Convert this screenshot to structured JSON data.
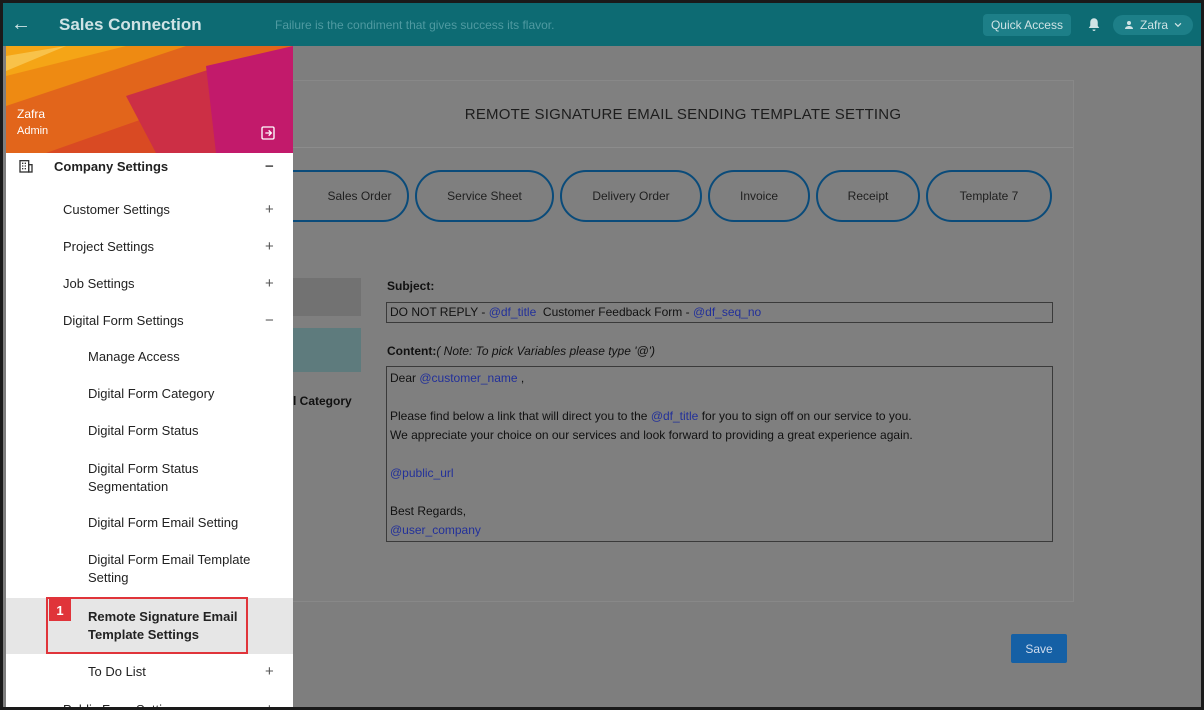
{
  "topbar": {
    "app_title": "Sales Connection",
    "quote": "Failure is the condiment that gives success its flavor.",
    "quick_access": "Quick Access",
    "user_name": "Zafra"
  },
  "panel": {
    "title": "REMOTE SIGNATURE EMAIL SENDING TEMPLATE SETTING",
    "tabs": [
      "Sales Order",
      "Service Sheet",
      "Delivery Order",
      "Invoice",
      "Receipt",
      "Template 7"
    ],
    "category_fragment": "l Category",
    "subject_label": "Subject:",
    "subject": {
      "p1": "DO NOT REPLY - ",
      "v1": "@df_title",
      "p2": "  Customer Feedback Form - ",
      "v2": "@df_seq_no"
    },
    "content_label": "Content:",
    "content_note": "( Note: To pick Variables please type '@')",
    "content": {
      "greet": "Dear ",
      "greet_var": "@customer_name",
      "greet_end": " ,",
      "line1_a": "Please find below a link that will direct you to the ",
      "line1_var": "@df_title",
      "line1_b": " for you to sign off on our service to you.",
      "line2": "We appreciate your choice on our services and look forward to providing a great experience again.",
      "url_var": "@public_url",
      "regards": "Best Regards,",
      "company_var": "@user_company"
    },
    "save": "Save"
  },
  "sidebar": {
    "user_name": "Zafra",
    "user_role": "Admin",
    "company_settings": "Company Settings",
    "items": [
      "Customer Settings",
      "Project Settings",
      "Job Settings",
      "Digital Form Settings"
    ],
    "subitems": [
      "Manage Access",
      "Digital Form Category",
      "Digital Form Status",
      "Digital Form Status Segmentation",
      "Digital Form Email Setting",
      "Digital Form Email Template Setting",
      "Remote Signature Email Template Settings",
      "To Do List"
    ],
    "partial_item": "Public Form Settings",
    "annotation_number": "1",
    "plus": "+",
    "minus": "−"
  },
  "colors": {
    "topbar": "#0d6b73",
    "annotation": "#e0343a",
    "pill_border": "#0a4b7a",
    "variable": "#22309a"
  }
}
